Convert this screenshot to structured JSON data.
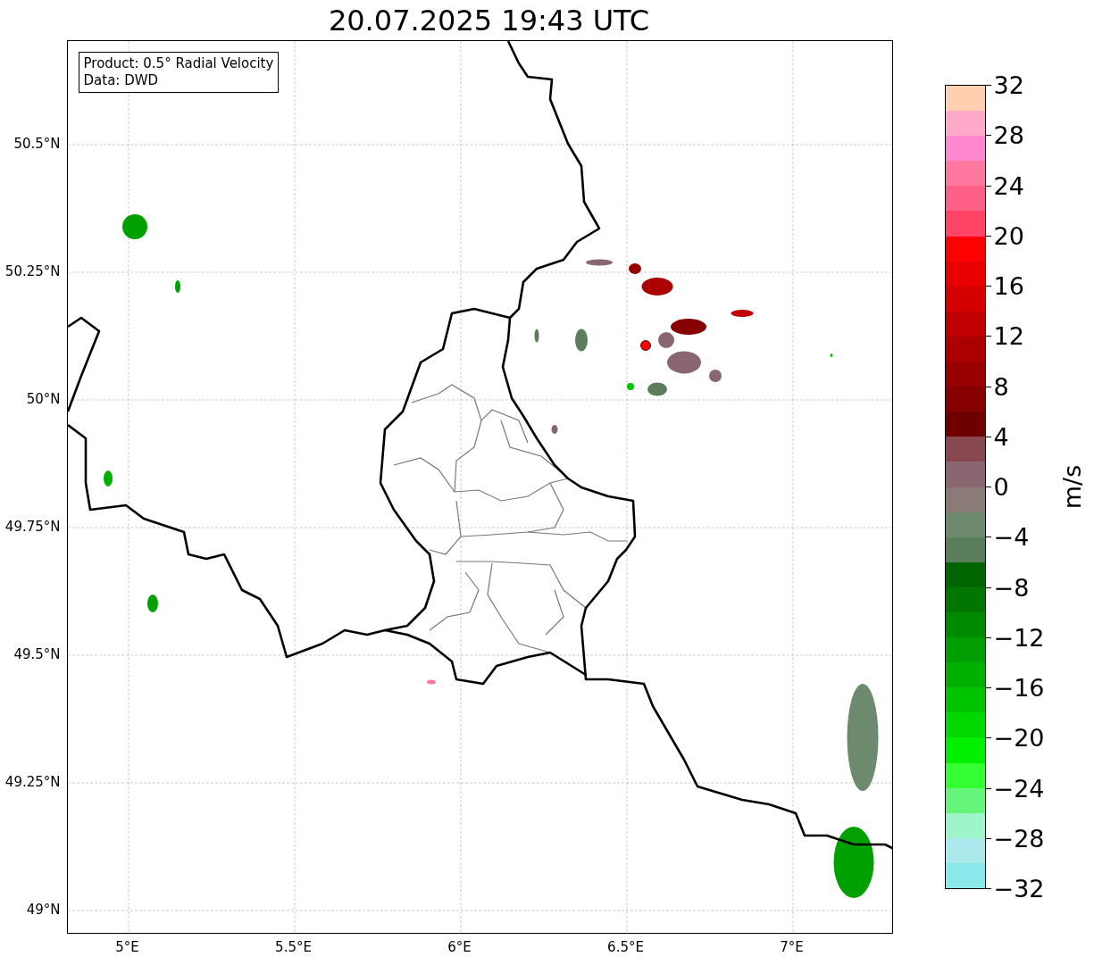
{
  "title": "20.07.2025 19:43 UTC",
  "info_box": {
    "lines": [
      "Product: 0.5° Radial Velocity",
      "Data: DWD"
    ]
  },
  "map": {
    "x_ticks": [
      "5°E",
      "5.5°E",
      "6°E",
      "6.5°E",
      "7°E"
    ],
    "y_ticks": [
      "50.5°N",
      "50.25°N",
      "50°N",
      "49.75°N",
      "49.5°N",
      "49.25°N",
      "49°N"
    ]
  },
  "colorbar": {
    "unit": "m/s",
    "ticks": [
      "32",
      "28",
      "24",
      "20",
      "16",
      "12",
      "8",
      "4",
      "0",
      "−4",
      "−8",
      "−12",
      "−16",
      "−20",
      "−24",
      "−28",
      "−32"
    ],
    "bands": [
      {
        "color": "#ffcfb0"
      },
      {
        "color": "#ffa8c8"
      },
      {
        "color": "#ff88d0"
      },
      {
        "color": "#ff78a0"
      },
      {
        "color": "#ff6088"
      },
      {
        "color": "#ff4466"
      },
      {
        "color": "#ff0000"
      },
      {
        "color": "#e80000"
      },
      {
        "color": "#d40000"
      },
      {
        "color": "#c00000"
      },
      {
        "color": "#ac0000"
      },
      {
        "color": "#980000"
      },
      {
        "color": "#860000"
      },
      {
        "color": "#6e0000"
      },
      {
        "color": "#884850"
      },
      {
        "color": "#8a6670"
      },
      {
        "color": "#8a7a78"
      },
      {
        "color": "#6e8a6e"
      },
      {
        "color": "#5a7d5a"
      },
      {
        "color": "#006400"
      },
      {
        "color": "#007600"
      },
      {
        "color": "#008a00"
      },
      {
        "color": "#009e00"
      },
      {
        "color": "#00b000"
      },
      {
        "color": "#00c400"
      },
      {
        "color": "#00d800"
      },
      {
        "color": "#00f000"
      },
      {
        "color": "#33ff33"
      },
      {
        "color": "#66f57a"
      },
      {
        "color": "#9ef5c9"
      },
      {
        "color": "#abe9ec"
      },
      {
        "color": "#88e8ea"
      }
    ]
  }
}
